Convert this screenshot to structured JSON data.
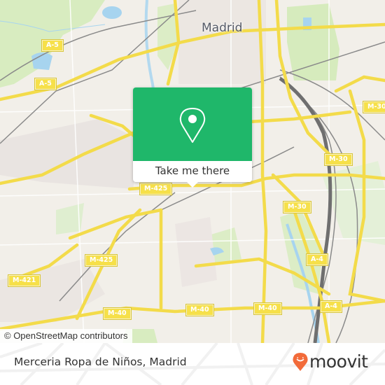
{
  "map": {
    "city_label": "Madrid",
    "road_labels": [
      {
        "id": "a5-top",
        "text": "A-5"
      },
      {
        "id": "a5-left",
        "text": "A-5"
      },
      {
        "id": "m30-right-top",
        "text": "M-30"
      },
      {
        "id": "m30-mid",
        "text": "M-30"
      },
      {
        "id": "m30-lower",
        "text": "M-30"
      },
      {
        "id": "m425-a",
        "text": "M-425"
      },
      {
        "id": "m425-b",
        "text": "M-425"
      },
      {
        "id": "m421",
        "text": "M-421"
      },
      {
        "id": "a4-upper",
        "text": "A-4"
      },
      {
        "id": "a4-lower",
        "text": "A-4"
      },
      {
        "id": "m40-left",
        "text": "M-40"
      },
      {
        "id": "m40-mid",
        "text": "M-40"
      },
      {
        "id": "m40-right",
        "text": "M-40"
      }
    ],
    "attribution": "© OpenStreetMap contributors",
    "colors": {
      "land": "#f2efe9",
      "park": "#d8ecc0",
      "water": "#a7d4ef",
      "road_major": "#f6e04a",
      "rail": "#8a8a8a"
    }
  },
  "popup": {
    "icon": "map-pin-icon",
    "button_label": "Take me there",
    "accent_color": "#1fb76a"
  },
  "footer": {
    "place_name": "Merceria Ropa de Niños, Madrid",
    "brand": {
      "icon": "moovit-smiley-pin-icon",
      "name": "moovit",
      "icon_color": "#f26b3a"
    }
  }
}
